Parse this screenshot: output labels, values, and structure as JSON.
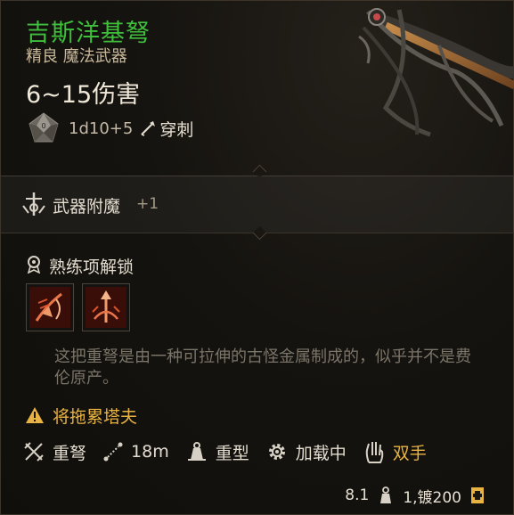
{
  "item": {
    "name": "吉斯洋基弩",
    "subtitle": "精良 魔法武器",
    "damage": "6~15伤害",
    "dice_roll": "1d10+5",
    "damage_type": "穿刺"
  },
  "enchantment": {
    "label": "武器附魔",
    "bonus": "+1"
  },
  "proficiency": {
    "label": "熟练项解锁"
  },
  "description": "这把重弩是由一种可拉伸的古怪金属制成的，似乎并不是费伦原产。",
  "warning": {
    "label": "将拖累塔夫"
  },
  "properties": [
    {
      "label": "重弩",
      "icon": "crossbow-icon"
    },
    {
      "label": "18m",
      "icon": "range-icon"
    },
    {
      "label": "重型",
      "icon": "weight-icon"
    },
    {
      "label": "加载中",
      "icon": "gear-icon"
    },
    {
      "label": "双手",
      "icon": "two-hand-icon"
    }
  ],
  "footer": {
    "weight": "8.1",
    "price": "1,镀200"
  },
  "colors": {
    "rarity_green": "#3fbf3c",
    "warning_gold": "#e8b342",
    "text_light": "#e3dccf",
    "text_muted": "#7b7468"
  }
}
